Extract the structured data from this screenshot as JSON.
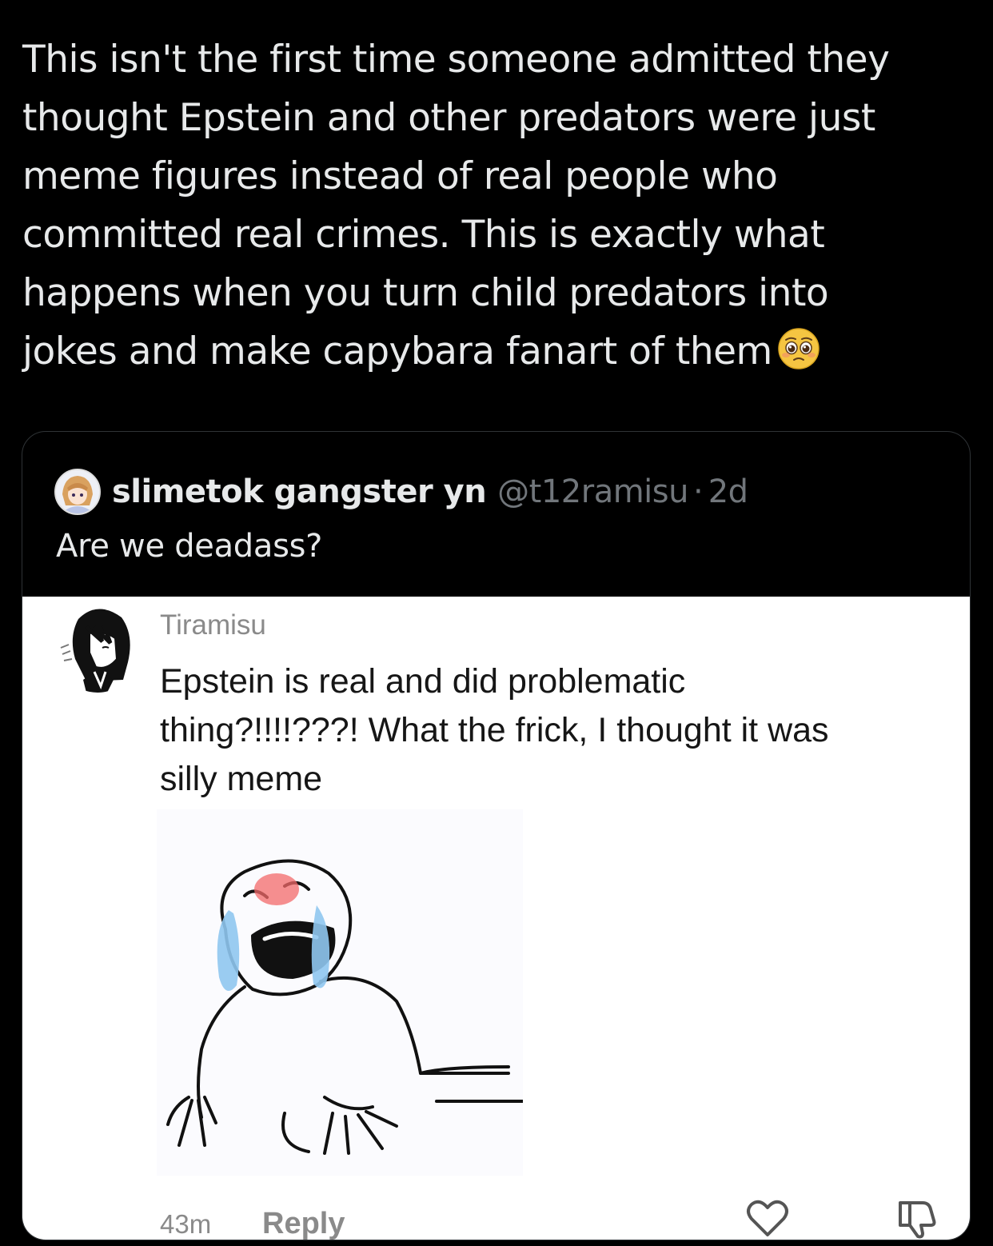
{
  "tweet": {
    "lines": [
      "This isn't the first time someone admitted they",
      "thought Epstein and other predators were just",
      "meme figures instead of real people who",
      "committed real crimes. This is exactly what",
      "happens when you turn child predators into",
      "jokes and make capybara fanart of them"
    ],
    "emoji": "pleading-face-icon"
  },
  "quote": {
    "display_name": "slimetok gangster yn",
    "handle": "@t12ramisu",
    "separator": "·",
    "time": "2d",
    "text": "Are we deadass?"
  },
  "comment": {
    "name": "Tiramisu",
    "lines": [
      "Epstein is real and did problematic",
      "thing?!!!!???! What the frick, I thought it was",
      "silly meme"
    ],
    "time": "43m",
    "reply_label": "Reply",
    "like_icon": "heart-icon",
    "dislike_icon": "thumbs-down-icon"
  },
  "colors": {
    "background": "#000000",
    "text": "#e7e9ea",
    "muted": "#71767b",
    "card_border": "#2f3336",
    "comment_bg": "#ffffff"
  }
}
